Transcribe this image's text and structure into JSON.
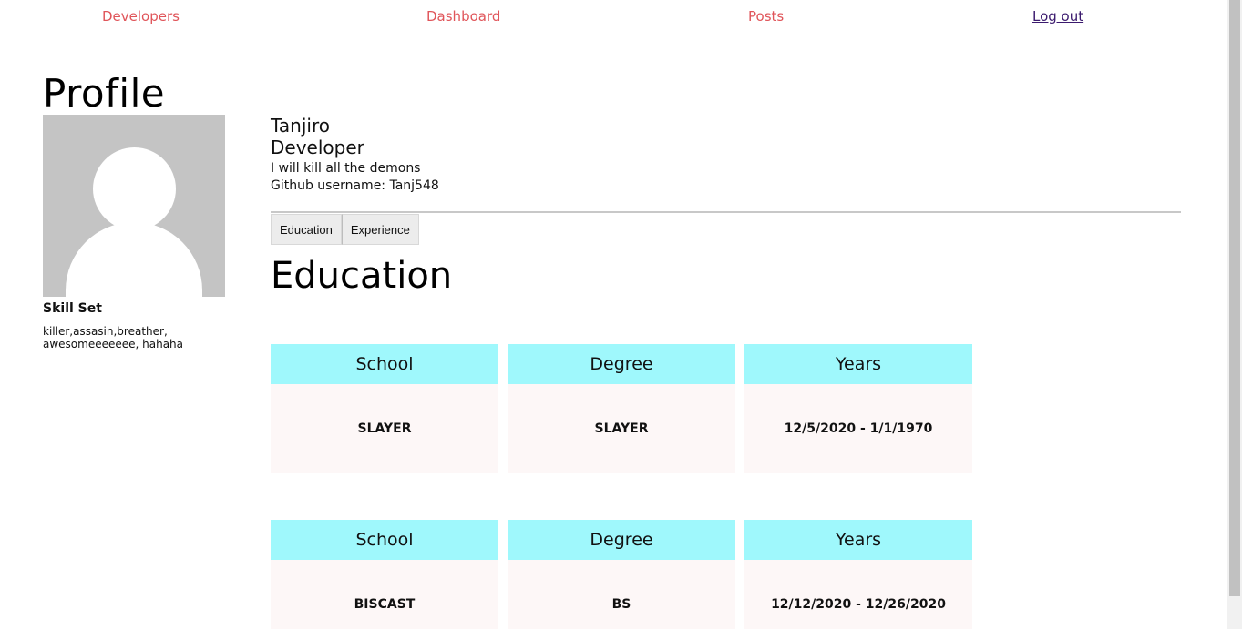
{
  "nav": {
    "developers": "Developers",
    "dashboard": "Dashboard",
    "posts": "Posts",
    "logout": "Log out"
  },
  "page_title": "Profile",
  "profile": {
    "name": "Tanjiro",
    "role": "Developer",
    "bio": "I will kill all the demons",
    "github": "Github username: Tanj548",
    "skills_title": "Skill Set",
    "skills": "killer,assasin,breather, awesomeeeeeee, hahaha"
  },
  "tabs": [
    "Education",
    "Experience"
  ],
  "section_title": "Education",
  "education": [
    {
      "headers": [
        "School",
        "Degree",
        "Years"
      ],
      "values": [
        "SLAYER",
        "SLAYER",
        "12/5/2020 - 1/1/1970"
      ]
    },
    {
      "headers": [
        "School",
        "Degree",
        "Years"
      ],
      "values": [
        "BISCAST",
        "BS",
        "12/12/2020 - 12/26/2020"
      ]
    }
  ],
  "colors": {
    "nav_link": "#e0555a",
    "header_cell": "#9ff8fc",
    "value_cell": "#fdf7f7"
  }
}
